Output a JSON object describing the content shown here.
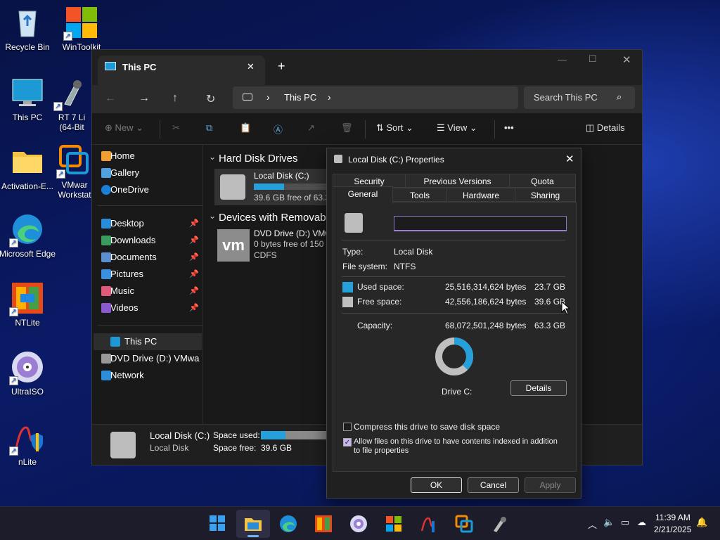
{
  "desktop": {
    "icons": [
      {
        "label": "Recycle Bin",
        "icon": "recycle-bin-icon"
      },
      {
        "label": "WinToolkit",
        "icon": "windows-logo-icon"
      },
      {
        "label": "This PC",
        "icon": "monitor-icon"
      },
      {
        "label": "RT 7 Li (64-Bit",
        "icon": "rt7-icon"
      },
      {
        "label": "Activation-E...",
        "icon": "folder-icon"
      },
      {
        "label": "VMwar Workstat",
        "icon": "vmware-icon"
      },
      {
        "label": "Microsoft Edge",
        "icon": "edge-icon"
      },
      {
        "label": "NTLite",
        "icon": "ntlite-icon"
      },
      {
        "label": "UltraISO",
        "icon": "disc-icon"
      },
      {
        "label": "nLite",
        "icon": "nlite-icon"
      }
    ]
  },
  "explorer": {
    "tab_title": "This PC",
    "new_tab": "+",
    "window_controls": {
      "minimize": "—",
      "maximize": "☐",
      "close": "✕"
    },
    "address": {
      "location": "This PC",
      "sep": "›"
    },
    "search_placeholder": "Search This PC",
    "commands": {
      "new": "New",
      "sort": "Sort",
      "view": "View",
      "more": "•••",
      "details": "Details"
    },
    "sidebar": {
      "top": [
        "Home",
        "Gallery",
        "OneDrive"
      ],
      "quick": [
        "Desktop",
        "Downloads",
        "Documents",
        "Pictures",
        "Music",
        "Videos"
      ],
      "bottom": [
        "This PC",
        "DVD Drive (D:) VMwa",
        "Network"
      ]
    },
    "groups": {
      "hard_disks": "Hard Disk Drives",
      "removable": "Devices with Removabl"
    },
    "drive_c": {
      "name": "Local Disk (C:)",
      "free": "39.6 GB free of 63.3",
      "used_fraction": 0.375
    },
    "drive_d": {
      "name": "DVD Drive (D:) VMw",
      "free": "0 bytes free of 150 M",
      "fs": "CDFS"
    },
    "status": {
      "name": "Local Disk (C:)",
      "type": "Local Disk",
      "space_used_label": "Space used:",
      "space_free_label": "Space free:",
      "space_free": "39.6 GB",
      "used_fraction": 0.375
    }
  },
  "dialog": {
    "title": "Local Disk (C:) Properties",
    "close": "✕",
    "tabs_back": [
      "Security",
      "Previous Versions",
      "Quota"
    ],
    "tabs_front": [
      "General",
      "Tools",
      "Hardware",
      "Sharing"
    ],
    "name_value": "",
    "type_label": "Type:",
    "type_value": "Local Disk",
    "fs_label": "File system:",
    "fs_value": "NTFS",
    "used_label": "Used space:",
    "used_bytes": "25,516,314,624 bytes",
    "used_gb": "23.7 GB",
    "free_label": "Free space:",
    "free_bytes": "42,556,186,624 bytes",
    "free_gb": "39.6 GB",
    "cap_label": "Capacity:",
    "cap_bytes": "68,072,501,248 bytes",
    "cap_gb": "63.3 GB",
    "drive_label": "Drive C:",
    "details_btn": "Details",
    "compress": "Compress this drive to save disk space",
    "index": "Allow files on this drive to have contents indexed in addition to file properties",
    "ok": "OK",
    "cancel": "Cancel",
    "apply": "Apply",
    "used_fraction": 0.375,
    "colors": {
      "used": "#26a0da",
      "free": "#bfbfbf"
    }
  },
  "taskbar": {
    "time": "11:39 AM",
    "date": "2/21/2025",
    "apps": [
      "start-icon",
      "file-explorer-icon",
      "edge-icon",
      "ntlite-icon",
      "ultraiso-icon",
      "wintoolkit-icon",
      "nlite-icon",
      "vmware-icon",
      "rt7-icon"
    ]
  }
}
